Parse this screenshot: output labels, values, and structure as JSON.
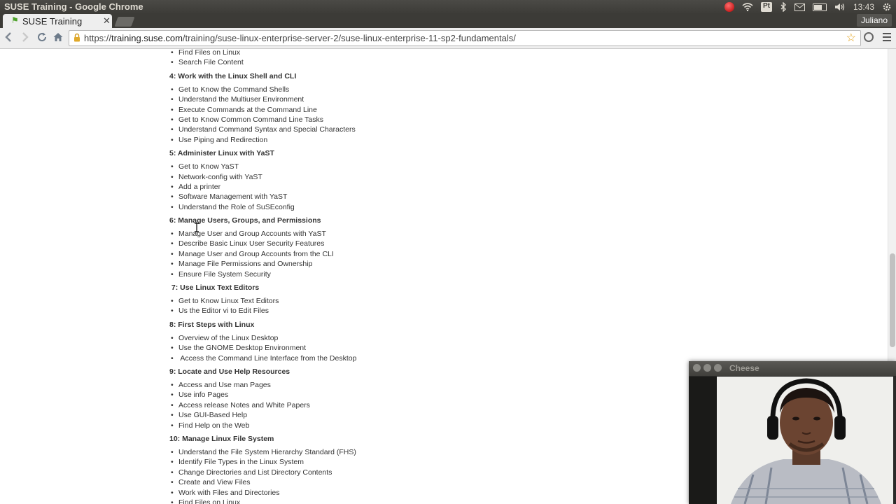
{
  "os": {
    "window_title": "SUSE Training - Google Chrome",
    "keyboard_indicator": "Pt",
    "time": "13:43"
  },
  "browser": {
    "tab_title": "SUSE Training",
    "user": "Juliano",
    "url_prefix": "https://",
    "url_host": "training.suse.com",
    "url_path": "/training/suse-linux-enterprise-server-2/suse-linux-enterprise-11-sp2-fundamentals/"
  },
  "top_items": [
    "Find Files on Linux",
    "Search File Content"
  ],
  "sections": [
    {
      "heading": "4: Work with the Linux Shell and CLI",
      "items": [
        "Get to Know the Command Shells",
        "Understand the Multiuser Environment",
        "Execute Commands at the Command Line",
        "Get to Know Common Command Line Tasks",
        "Understand Command Syntax and Special Characters",
        "Use Piping and Redirection"
      ]
    },
    {
      "heading": "5: Administer Linux with YaST",
      "items": [
        "Get to Know YaST",
        "Network-config with YaST",
        "Add a printer",
        "Software Management with YaST",
        "Understand the Role of SuSEconfig"
      ]
    },
    {
      "heading": "6: Manage Users, Groups, and Permissions",
      "items": [
        "Manage User and Group Accounts with YaST",
        "Describe Basic Linux User Security Features",
        "Manage User and Group Accounts from the CLI",
        "Manage File Permissions and Ownership",
        "Ensure File System Security"
      ]
    },
    {
      "heading": " 7: Use Linux Text Editors",
      "items": [
        "Get to Know Linux Text Editors",
        "Us the Editor vi to Edit Files"
      ]
    },
    {
      "heading": "8: First Steps with Linux",
      "items": [
        "Overview of the Linux Desktop",
        "Use the GNOME Desktop Environment",
        " Access the Command Line Interface from the Desktop"
      ]
    },
    {
      "heading": "9: Locate and Use Help Resources",
      "items": [
        "Access and Use man Pages",
        "Use info Pages",
        "Access release Notes and White Papers",
        "Use GUI-Based Help",
        "Find Help on the Web"
      ]
    },
    {
      "heading": "10: Manage Linux File System",
      "items": [
        "Understand the File System Hierarchy Standard (FHS)",
        "Identify File Types in the Linux System",
        "Change Directories and List Directory Contents",
        "Create and View Files",
        "Work with Files and Directories",
        "Find Files on Linux"
      ]
    }
  ],
  "cheese": {
    "title": "Cheese"
  },
  "colors": {
    "os_bar": "#3c3b37",
    "toolbar": "#eeeeee",
    "text": "#333333",
    "star": "#e3a21a"
  }
}
